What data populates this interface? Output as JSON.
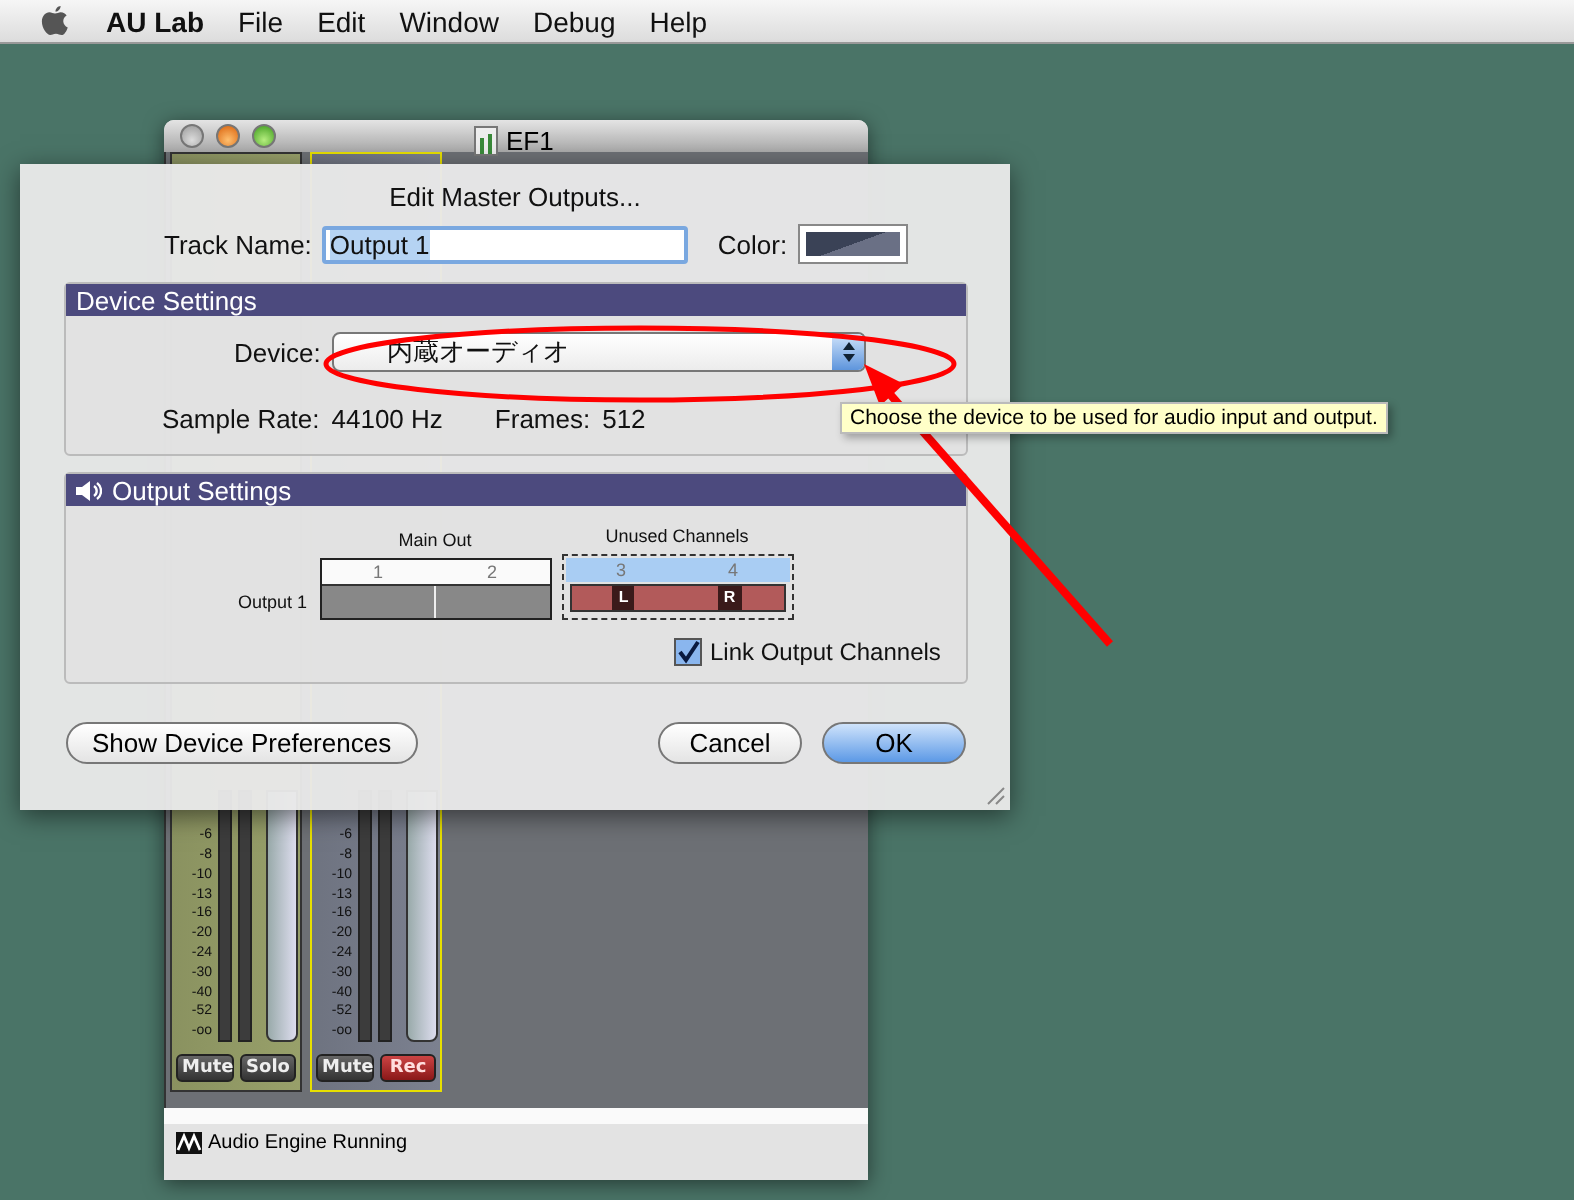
{
  "menu_bar": {
    "items": [
      {
        "label": "AU Lab",
        "kind": "app"
      },
      {
        "label": "File",
        "kind": "menu"
      },
      {
        "label": "Edit",
        "kind": "menu"
      },
      {
        "label": "Window",
        "kind": "menu"
      },
      {
        "label": "Debug",
        "kind": "menu"
      },
      {
        "label": "Help",
        "kind": "menu"
      }
    ]
  },
  "mixer_window": {
    "title": "EF1",
    "strips": [
      {
        "selected": false,
        "scale": [
          "-6",
          "-8",
          "-10",
          "-13",
          "-16",
          "-20",
          "-24",
          "-30",
          "-40",
          "-52",
          "-oo"
        ],
        "buttons": [
          {
            "label": "Mute",
            "on": false
          },
          {
            "label": "Solo",
            "on": false
          }
        ]
      },
      {
        "selected": true,
        "scale": [
          "-6",
          "-8",
          "-10",
          "-13",
          "-16",
          "-20",
          "-24",
          "-30",
          "-40",
          "-52",
          "-oo"
        ],
        "buttons": [
          {
            "label": "Mute",
            "on": false
          },
          {
            "label": "Rec",
            "on": true
          }
        ]
      }
    ],
    "status": "Audio Engine Running"
  },
  "dialog": {
    "title": "Edit Master Outputs...",
    "track_name_label": "Track Name:",
    "track_name": "Output 1",
    "color_label": "Color:",
    "device_settings": {
      "header": "Device Settings",
      "device_label": "Device:",
      "device": "内蔵オーディオ",
      "sample_rate_label": "Sample Rate:",
      "sample_rate": "44100 Hz",
      "frames_label": "Frames:",
      "frames": "512"
    },
    "output_settings": {
      "header": "Output Settings",
      "row_label": "Output 1",
      "groups": [
        {
          "label": "Main Out",
          "kind": "used",
          "selected": false,
          "channels": [
            "1",
            "2"
          ]
        },
        {
          "label": "Unused Channels",
          "kind": "unused",
          "selected": true,
          "channels": [
            "3",
            "4"
          ],
          "assign": [
            "L",
            "R"
          ]
        }
      ],
      "link_channels": {
        "label": "Link Output Channels",
        "checked": true
      }
    },
    "buttons": [
      {
        "label": "Show Device Preferences",
        "kind": "left",
        "default": false
      },
      {
        "label": "Cancel",
        "kind": "right",
        "default": false
      },
      {
        "label": "OK",
        "kind": "right",
        "default": true
      }
    ]
  },
  "tooltip": "Choose the device to be used for audio input and output."
}
